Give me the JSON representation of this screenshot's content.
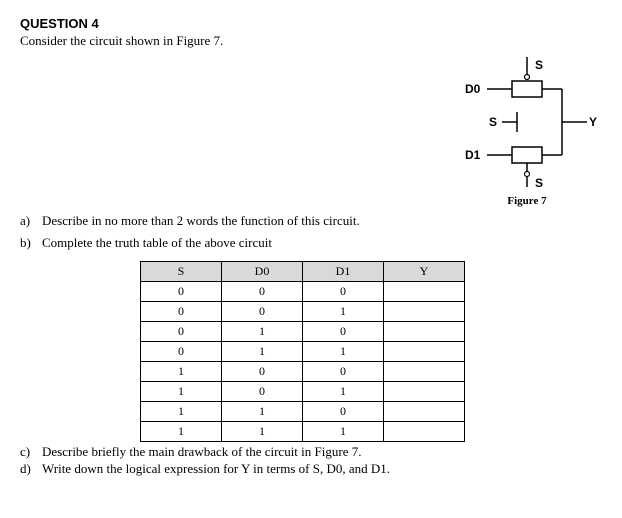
{
  "heading": "QUESTION 4",
  "prompt": "Consider the circuit shown in Figure 7.",
  "figure": {
    "caption": "Figure 7",
    "labels": {
      "d0": "D0",
      "d1": "D1",
      "s_top": "S",
      "s_left": "S",
      "s_bottom": "S",
      "y": "Y"
    }
  },
  "questions": {
    "a": {
      "marker": "a)",
      "text": "Describe in no more than 2 words the function of this circuit."
    },
    "b": {
      "marker": "b)",
      "text": "Complete the truth table of the above circuit"
    },
    "c": {
      "marker": "c)",
      "text": "Describe briefly the main drawback of the circuit in Figure 7."
    },
    "d": {
      "marker": "d)",
      "text": "Write down the logical expression for Y in terms of S, D0, and D1."
    }
  },
  "table": {
    "headers": [
      "S",
      "D0",
      "D1",
      "Y"
    ],
    "rows": [
      [
        "0",
        "0",
        "0",
        ""
      ],
      [
        "0",
        "0",
        "1",
        ""
      ],
      [
        "0",
        "1",
        "0",
        ""
      ],
      [
        "0",
        "1",
        "1",
        ""
      ],
      [
        "1",
        "0",
        "0",
        ""
      ],
      [
        "1",
        "0",
        "1",
        ""
      ],
      [
        "1",
        "1",
        "0",
        ""
      ],
      [
        "1",
        "1",
        "1",
        ""
      ]
    ]
  }
}
